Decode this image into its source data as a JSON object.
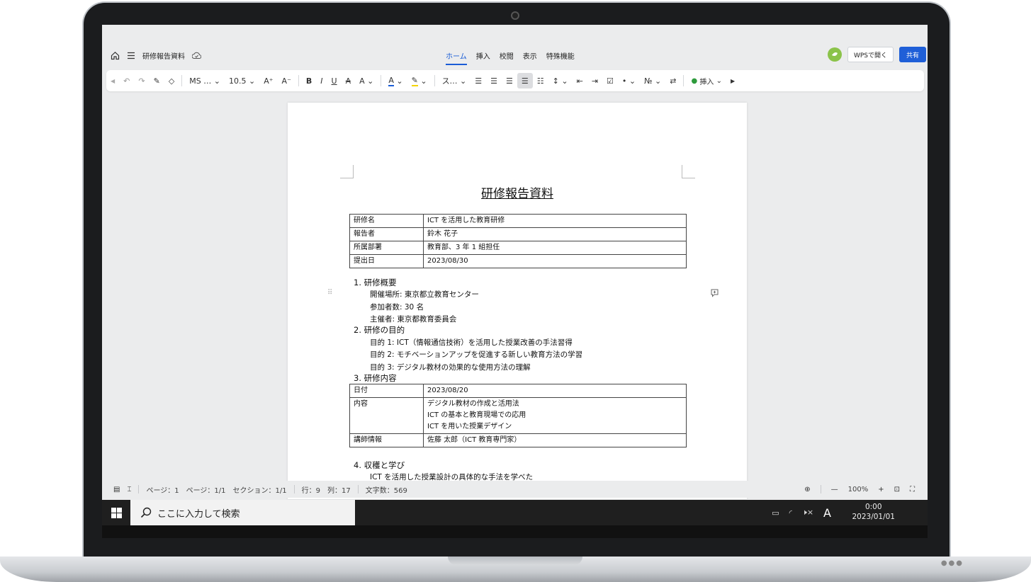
{
  "window": {
    "doc_name": "研修報告資料",
    "tabs": [
      "ホーム",
      "挿入",
      "校閲",
      "表示",
      "特殊機能"
    ],
    "active_tab": 0,
    "open_button": "WPSで開く",
    "share_button": "共有"
  },
  "toolbar": {
    "font_name": "MS …",
    "font_size": "10.5",
    "style": "ス…",
    "insert_label": "挿入"
  },
  "document": {
    "title": "研修報告資料",
    "info_table": [
      {
        "key": "研修名",
        "value": "ICT を活用した教育研修"
      },
      {
        "key": "報告者",
        "value": "鈴木 花子"
      },
      {
        "key": "所属部署",
        "value": "教育部、3 年 1 組担任"
      },
      {
        "key": "提出日",
        "value": "2023/08/30"
      }
    ],
    "section1": {
      "heading": "1. 研修概要",
      "items": [
        "開催場所: 東京都立教育センター",
        "参加者数: 30 名",
        "主催者: 東京都教育委員会"
      ]
    },
    "section2": {
      "heading": "2. 研修の目的",
      "items": [
        "目的 1: ICT（情報通信技術）を活用した授業改善の手法習得",
        "目的 2: モチベーションアップを促進する新しい教育方法の学習",
        "目的 3: デジタル教材の効果的な使用方法の理解"
      ]
    },
    "section3": {
      "heading": "3. 研修内容",
      "table": {
        "date_key": "日付",
        "date_value": "2023/08/20",
        "content_key": "内容",
        "content_values": [
          "デジタル教材の作成と活用法",
          "ICT の基本と教育現場での応用",
          "ICT を用いた授業デザイン"
        ],
        "lecturer_key": "講師情報",
        "lecturer_value": "佐藤 太郎（ICT 教育専門家）"
      }
    },
    "section4": {
      "heading": "4. 収穫と学び",
      "first_line": "ICT を活用した授業設計の具体的な手法を学べた"
    }
  },
  "status": {
    "page": "ページ：1",
    "pages": "ページ：1/1",
    "section": "セクション：1/1",
    "row": "行：9",
    "col": "列：17",
    "chars": "文字数：569",
    "zoom": "100%"
  },
  "taskbar": {
    "search_placeholder": "ここに入力して検索",
    "ime": "A",
    "time": "0:00",
    "date": "2023/01/01"
  }
}
